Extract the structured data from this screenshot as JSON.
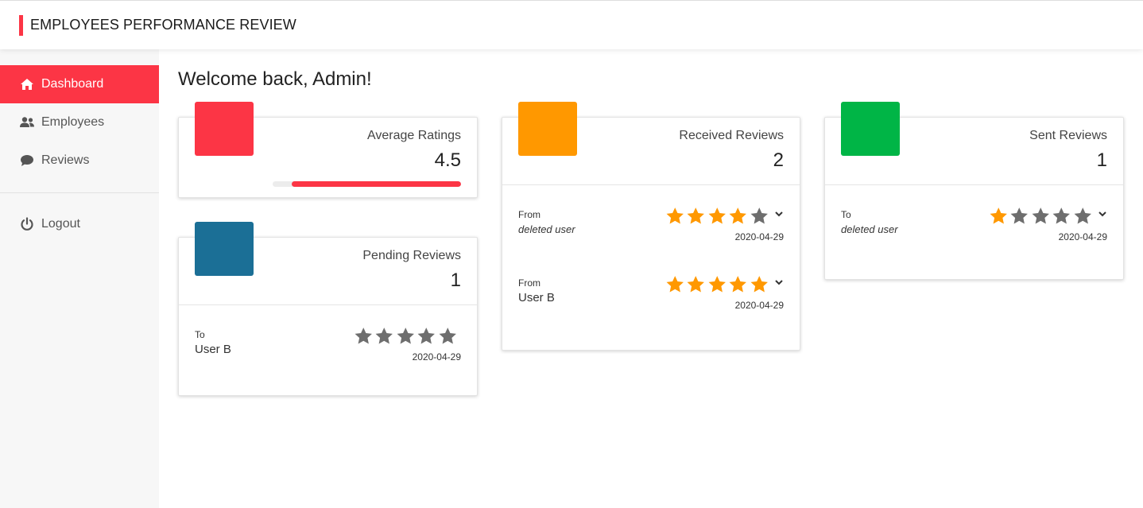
{
  "colors": {
    "brand_red": "#fc3545",
    "orange": "#ff9800",
    "green": "#00b546",
    "teal": "#1b6f96",
    "star_on": "#ff9800",
    "star_off": "#6e6e6e"
  },
  "header": {
    "title": "EMPLOYEES PERFORMANCE REVIEW"
  },
  "sidebar": {
    "items": [
      {
        "label": "Dashboard",
        "icon": "home-icon",
        "active": true
      },
      {
        "label": "Employees",
        "icon": "users-icon",
        "active": false
      },
      {
        "label": "Reviews",
        "icon": "comment-icon",
        "active": false
      }
    ],
    "logout": {
      "label": "Logout",
      "icon": "power-icon"
    }
  },
  "main": {
    "welcome": "Welcome back, Admin!",
    "average": {
      "title": "Average Ratings",
      "value": "4.5",
      "progress": 0.9
    },
    "pending": {
      "title": "Pending Reviews",
      "value": "1",
      "reviews": [
        {
          "direction": "To",
          "user": "User B",
          "stars": 0,
          "date": "2020-04-29"
        }
      ]
    },
    "received": {
      "title": "Received Reviews",
      "value": "2",
      "reviews": [
        {
          "direction": "From",
          "user": "deleted user",
          "stars": 4,
          "date": "2020-04-29"
        },
        {
          "direction": "From",
          "user": "User B",
          "stars": 5,
          "date": "2020-04-29"
        }
      ]
    },
    "sent": {
      "title": "Sent Reviews",
      "value": "1",
      "reviews": [
        {
          "direction": "To",
          "user": "deleted user",
          "stars": 1,
          "date": "2020-04-29"
        }
      ]
    }
  }
}
